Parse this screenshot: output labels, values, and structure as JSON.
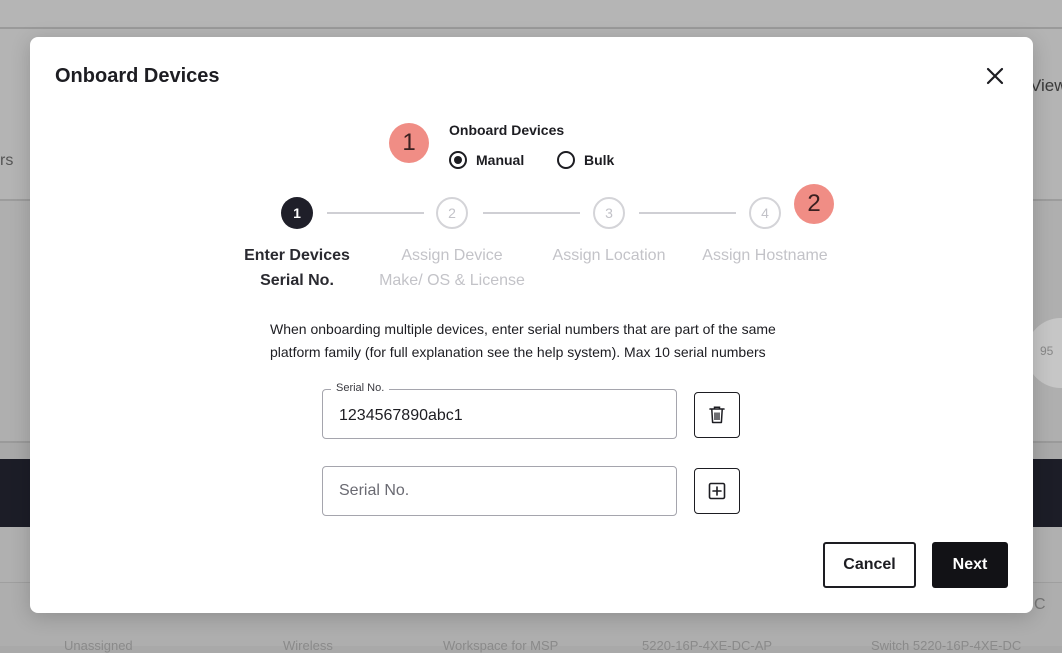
{
  "background": {
    "view_fragment": "View",
    "left_fragment": "rs",
    "gauge_value": "95",
    "right_fragment": "C",
    "footer_row": [
      "Unassigned",
      "Wireless",
      "Workspace for MSP",
      "5220-16P-4XE-DC-AP",
      "Switch 5220-16P-4XE-DC"
    ]
  },
  "modal": {
    "title": "Onboard Devices",
    "close_icon": "close-icon",
    "annotations": [
      "1",
      "2"
    ],
    "mode": {
      "label": "Onboard Devices",
      "options": [
        {
          "label": "Manual",
          "selected": true
        },
        {
          "label": "Bulk",
          "selected": false
        }
      ]
    },
    "stepper": {
      "steps": [
        {
          "number": "1",
          "line1": "Enter Devices",
          "line2": "Serial No.",
          "active": true
        },
        {
          "number": "2",
          "line1": "Assign Device",
          "line2": "Make/ OS & License",
          "active": false
        },
        {
          "number": "3",
          "line1": "Assign Location",
          "line2": "",
          "active": false
        },
        {
          "number": "4",
          "line1": "Assign Hostname",
          "line2": "",
          "active": false
        }
      ]
    },
    "instructions_line1": "When onboarding multiple devices, enter serial numbers that are part of the same",
    "instructions_line2": "platform family (for full explanation see the help system). Max 10 serial numbers",
    "serial_fields": [
      {
        "label": "Serial No.",
        "value": "1234567890abc1",
        "placeholder": "Serial No.",
        "action_icon": "trash-icon"
      },
      {
        "label": "",
        "value": "",
        "placeholder": "Serial No.",
        "action_icon": "plus-square-icon"
      }
    ],
    "buttons": {
      "cancel": "Cancel",
      "next": "Next"
    }
  }
}
